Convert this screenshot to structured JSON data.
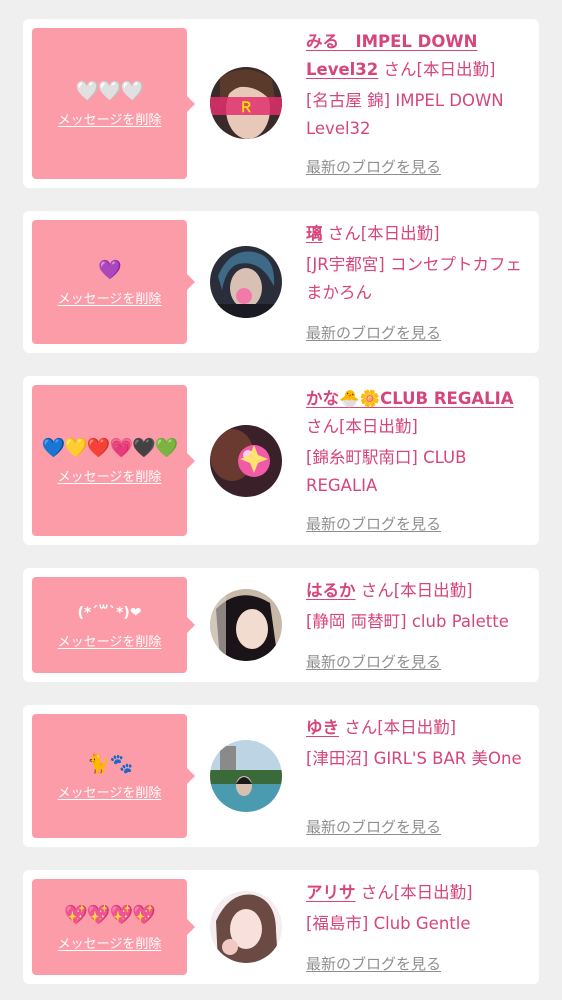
{
  "common": {
    "delete_label": "メッセージを削除",
    "blog_label": "最新のブログを見る",
    "san_label": "さん",
    "status_label": "[本日出勤]"
  },
  "colors": {
    "background": "#efeff0",
    "card": "#ffffff",
    "bubble": "#fd9ca9",
    "name_text": "#d6457c",
    "link_gray": "#8f8f8f"
  },
  "entries": [
    {
      "message": "🤍🤍🤍",
      "name": "みる　IMPEL DOWN Level32",
      "shop": "[名古屋 錦] IMPEL DOWN Level32"
    },
    {
      "message": "💜",
      "name": "璃",
      "shop": "[JR宇都宮] コンセプトカフェ まかろん"
    },
    {
      "message": "💙💛❤️💗🖤💚",
      "name": "かな🐣🌼CLUB REGALIA",
      "shop": "[錦糸町駅南口] CLUB REGALIA"
    },
    {
      "message": "(*´꒳`*)❤",
      "name": "はるか",
      "shop": "[静岡 両替町] club Palette"
    },
    {
      "message": "🐈🐾",
      "name": "ゆき",
      "shop": "[津田沼] GIRL'S BAR 美One"
    },
    {
      "message": "💖💖💖💖",
      "name": "アリサ",
      "shop": "[福島市] Club Gentle"
    }
  ]
}
